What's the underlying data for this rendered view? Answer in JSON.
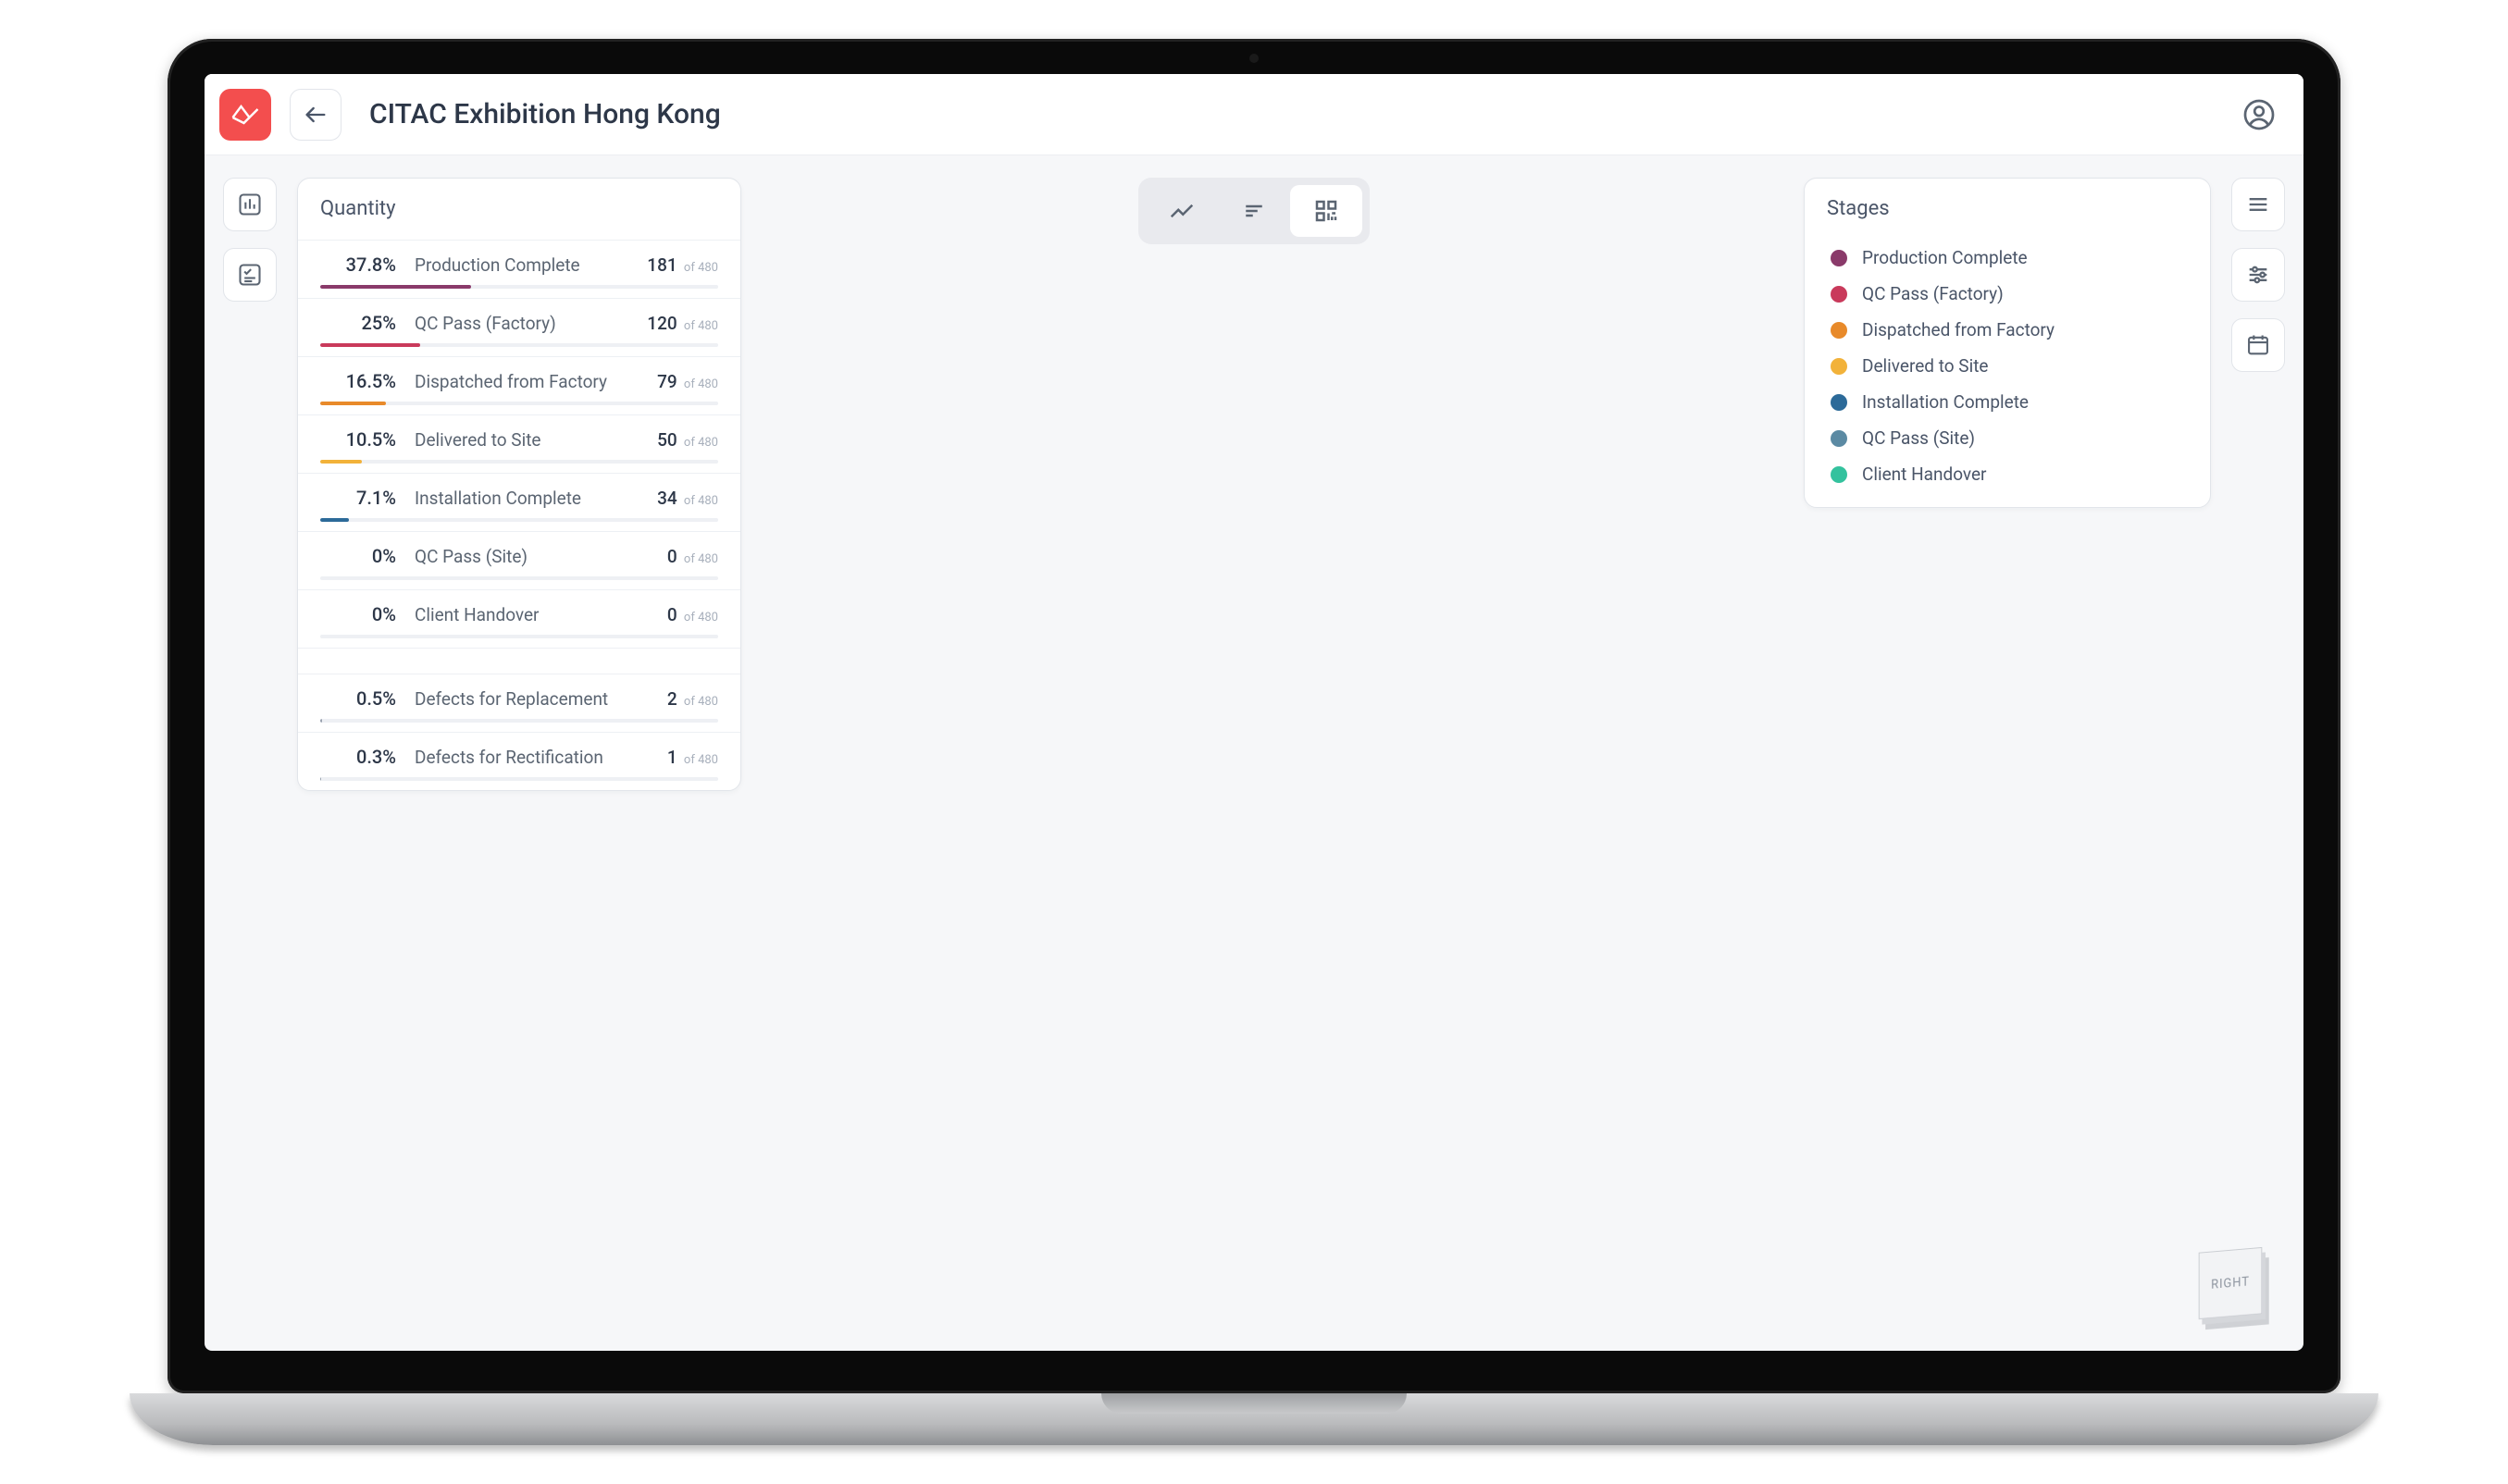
{
  "header": {
    "title": "CITAC Exhibition Hong Kong"
  },
  "quantity_panel": {
    "title": "Quantity",
    "total_suffix": "of 480",
    "metrics": [
      {
        "pct": "37.8%",
        "label": "Production Complete",
        "count": "181",
        "fill": 37.8,
        "color": "#8a3a6a"
      },
      {
        "pct": "25%",
        "label": "QC Pass (Factory)",
        "count": "120",
        "fill": 25,
        "color": "#c93a5b"
      },
      {
        "pct": "16.5%",
        "label": "Dispatched from Factory",
        "count": "79",
        "fill": 16.5,
        "color": "#e88a2a"
      },
      {
        "pct": "10.5%",
        "label": "Delivered to Site",
        "count": "50",
        "fill": 10.5,
        "color": "#f2b23a"
      },
      {
        "pct": "7.1%",
        "label": "Installation Complete",
        "count": "34",
        "fill": 7.1,
        "color": "#2c6a99"
      },
      {
        "pct": "0%",
        "label": "QC Pass (Site)",
        "count": "0",
        "fill": 0,
        "color": "#5b8aa3"
      },
      {
        "pct": "0%",
        "label": "Client Handover",
        "count": "0",
        "fill": 0,
        "color": "#34c29e"
      }
    ],
    "defects": [
      {
        "pct": "0.5%",
        "label": "Defects for Replacement",
        "count": "2",
        "fill": 0.5,
        "color": "#9aa2af"
      },
      {
        "pct": "0.3%",
        "label": "Defects for Rectification",
        "count": "1",
        "fill": 0.3,
        "color": "#9aa2af"
      }
    ]
  },
  "stages_panel": {
    "title": "Stages",
    "stages": [
      {
        "label": "Production Complete",
        "color": "#8a3a6a"
      },
      {
        "label": "QC Pass (Factory)",
        "color": "#c93a5b"
      },
      {
        "label": "Dispatched from Factory",
        "color": "#e88a2a"
      },
      {
        "label": "Delivered to Site",
        "color": "#f2b23a"
      },
      {
        "label": "Installation Complete",
        "color": "#2c6a99"
      },
      {
        "label": "QC Pass (Site)",
        "color": "#5b8aa3"
      },
      {
        "label": "Client Handover",
        "color": "#34c29e"
      }
    ]
  },
  "navcube": {
    "label": "RIGHT"
  },
  "building_colors": {
    "purple": "#8a3a6a",
    "red": "#c93a5b",
    "orange": "#e88a2a",
    "yellow": "#f2b23a",
    "blue": "#2c6a99"
  }
}
